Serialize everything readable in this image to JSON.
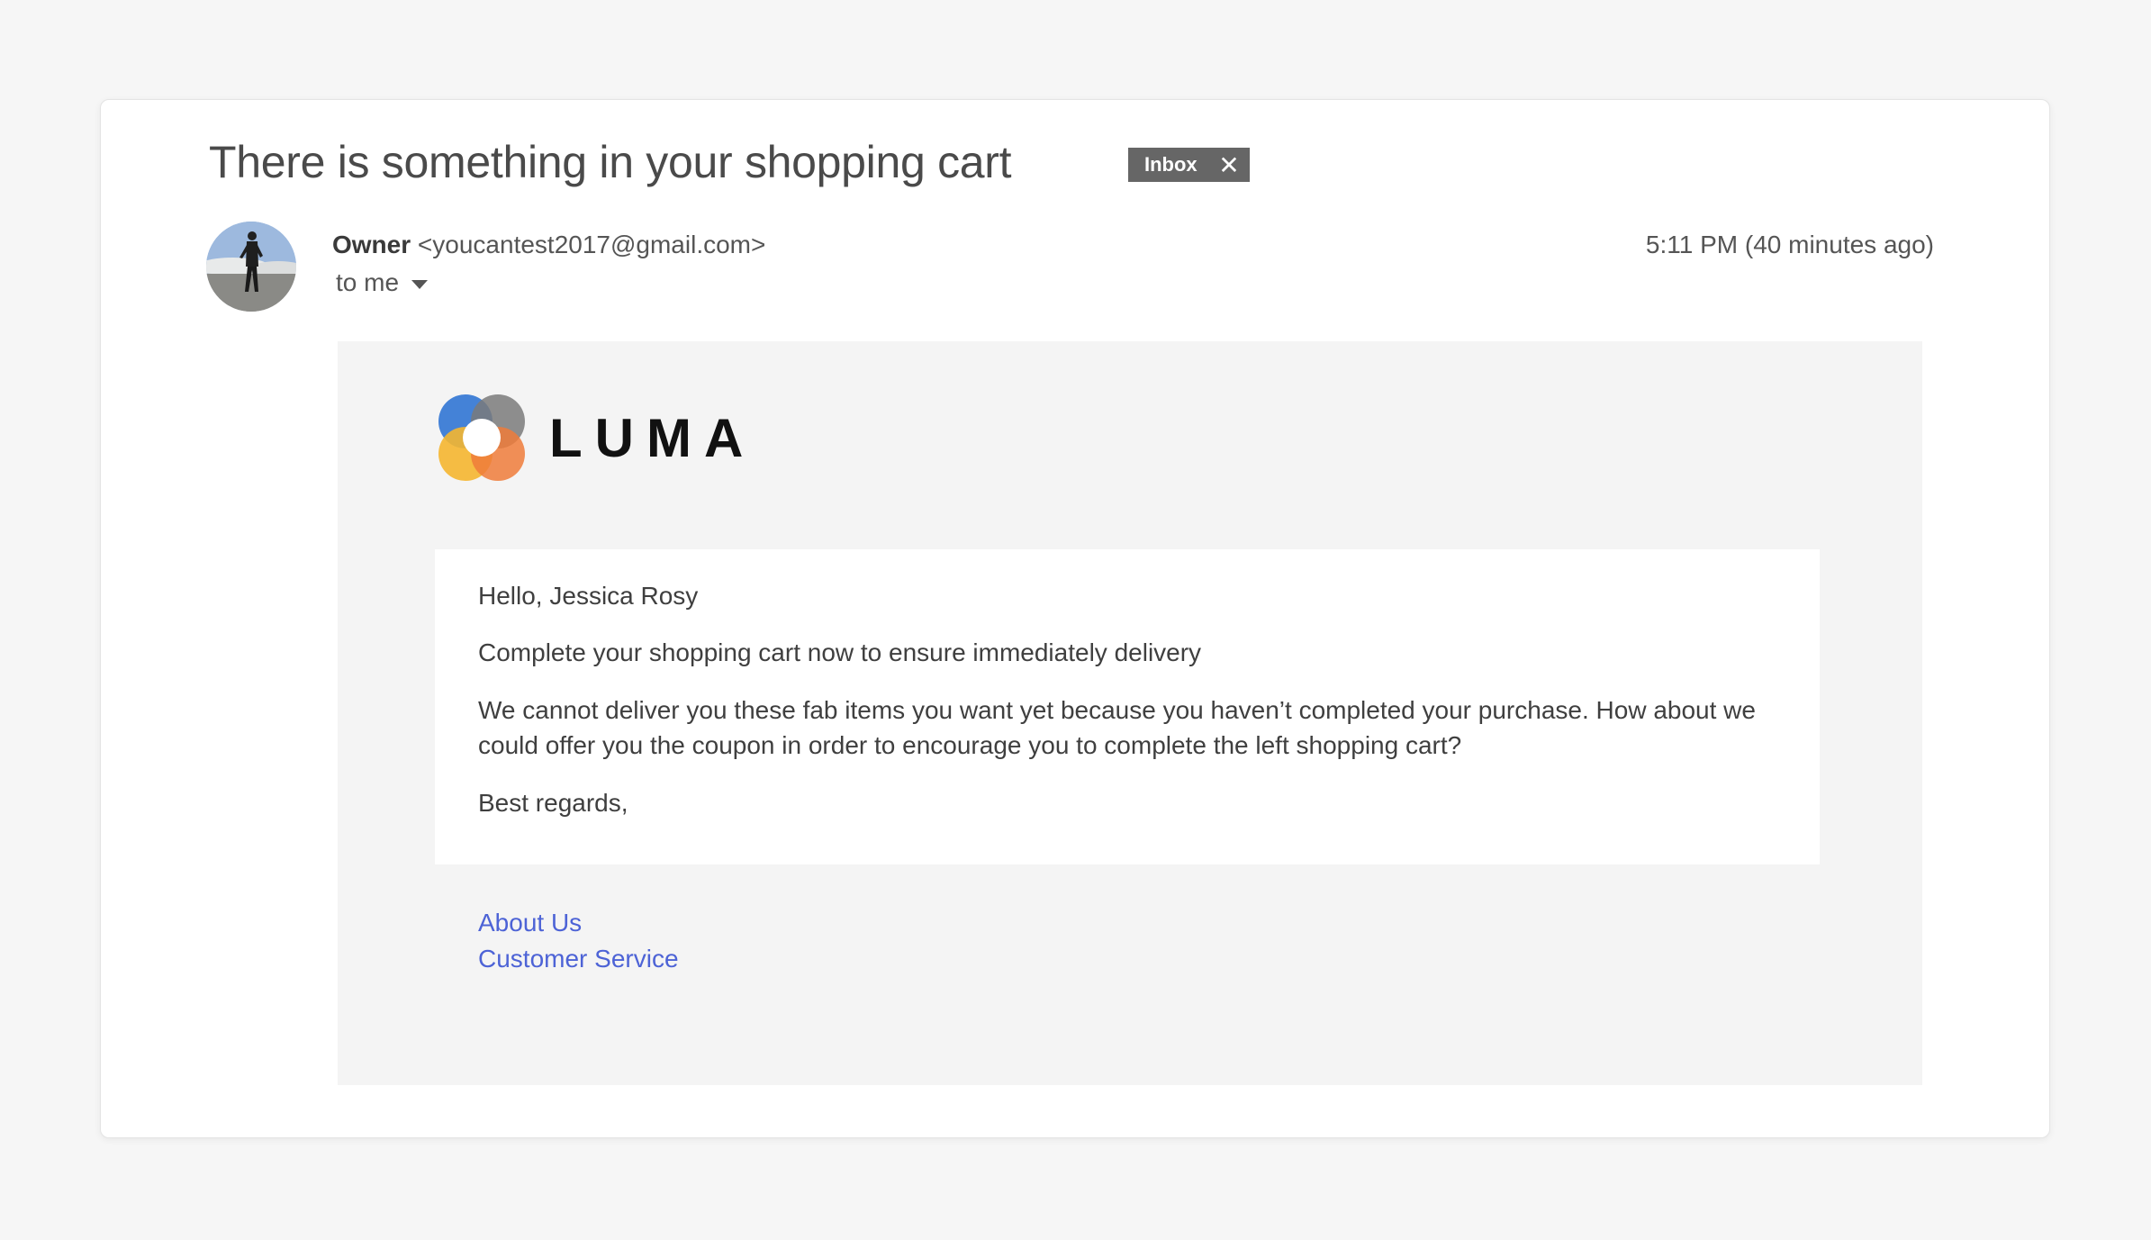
{
  "email": {
    "subject": "There is something in your shopping cart",
    "label": "Inbox",
    "label_remove_icon": "close-icon",
    "sender_name": "Owner",
    "sender_email": "<youcantest2017@gmail.com>",
    "recipient": "to me",
    "timestamp": "5:11 PM (40 minutes ago)"
  },
  "body": {
    "brand": "LUMA",
    "greeting": "Hello, Jessica Rosy",
    "headline": "Complete your shopping cart now to ensure immediately delivery",
    "paragraph": "We cannot deliver you these fab items you want yet because you haven’t completed your purchase. How about we could offer you the coupon in order to encourage you to complete the left shopping cart?",
    "signoff": "Best regards,",
    "footer_links": [
      "About Us",
      "Customer Service"
    ]
  },
  "colors": {
    "background": "#f6f6f6",
    "label_chip": "#666666",
    "link": "#4d63d6",
    "logo_blue": "#3a7bd5",
    "logo_gray": "#7a7a7a",
    "logo_yellow": "#f5b630",
    "logo_orange": "#ef7b3a"
  }
}
